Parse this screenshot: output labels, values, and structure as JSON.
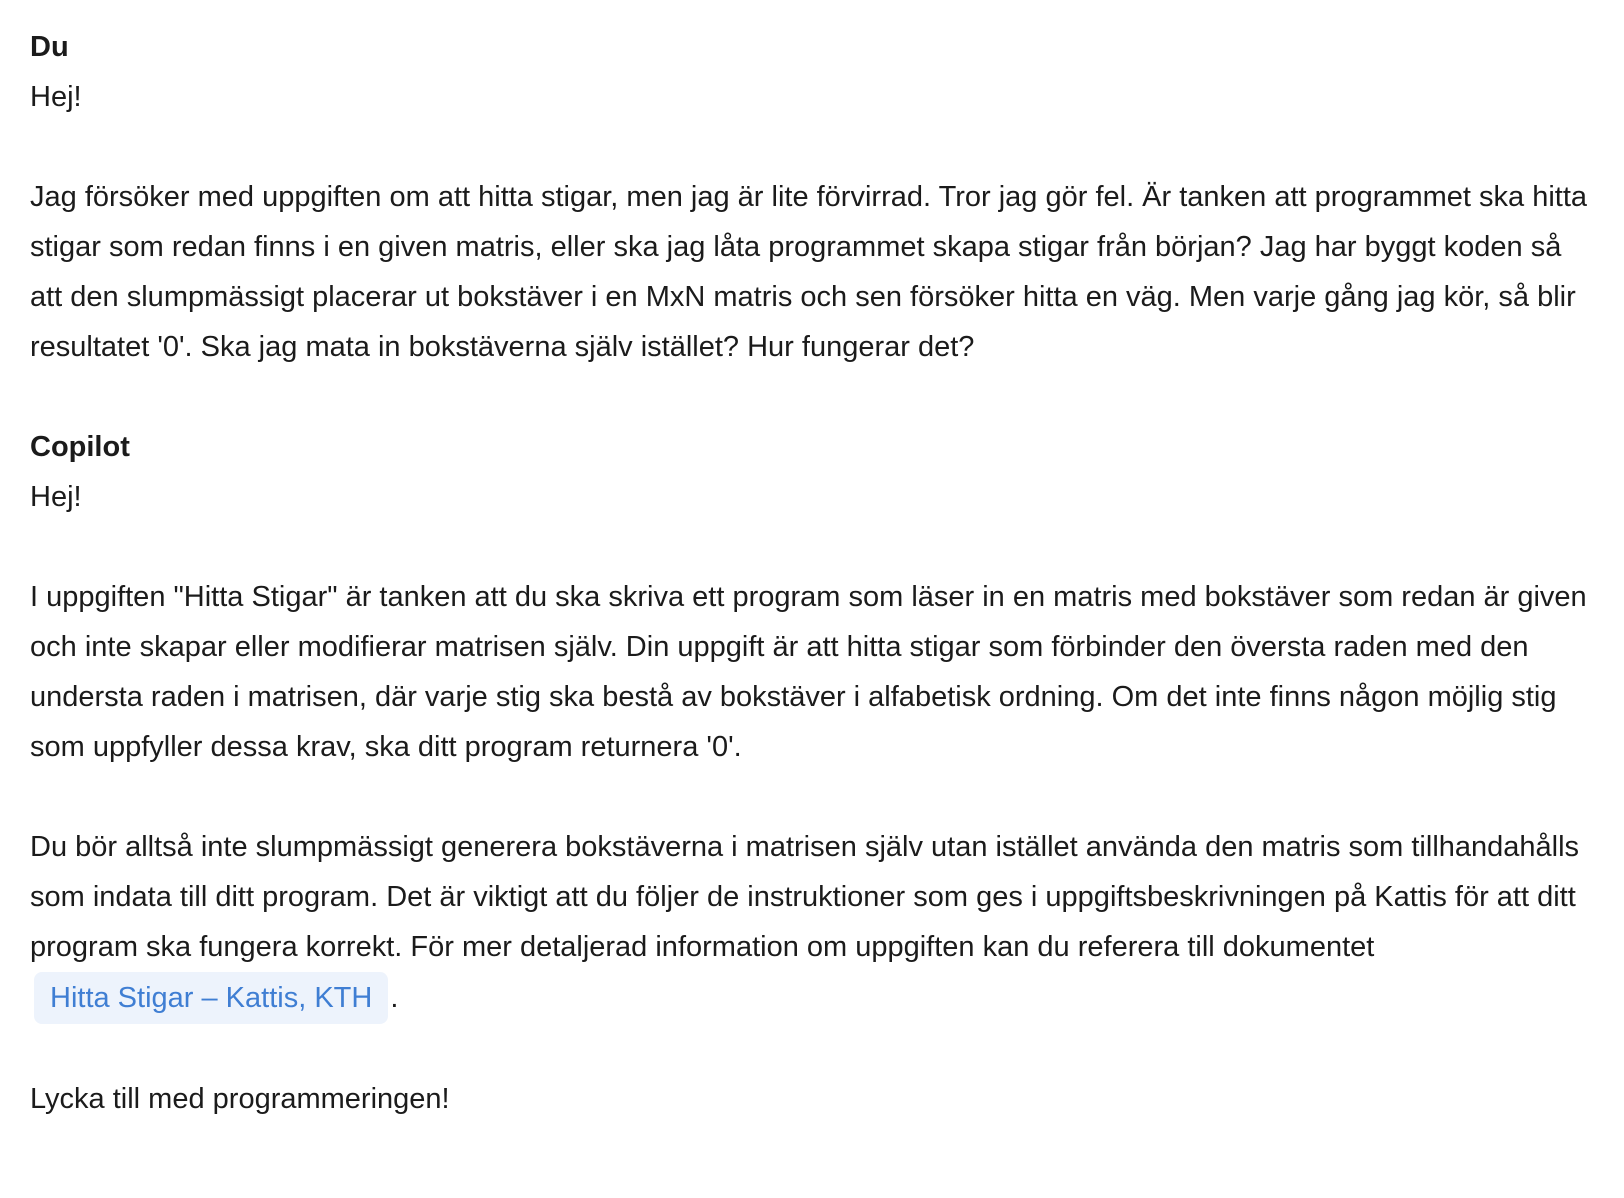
{
  "messages": [
    {
      "author": "Du",
      "paragraphs": [
        "Hej!",
        "Jag försöker med uppgiften om att hitta stigar, men jag är lite förvirrad. Tror jag gör fel. Är tanken att programmet ska hitta stigar som redan finns i en given matris, eller ska jag låta programmet skapa stigar från början? Jag har byggt koden så att den slumpmässigt placerar ut bokstäver i en MxN matris och sen försöker hitta en väg. Men varje gång jag kör, så blir resultatet '0'. Ska jag mata in bokstäverna själv istället? Hur fungerar det?"
      ]
    },
    {
      "author": "Copilot",
      "paragraphs": [
        "Hej!",
        "I uppgiften \"Hitta Stigar\" är tanken att du ska skriva ett program som läser in en matris med bokstäver som redan är given och inte skapar eller modifierar matrisen själv. Din uppgift är att hitta stigar som förbinder den översta raden med den understa raden i matrisen, där varje stig ska bestå av bokstäver i alfabetisk ordning. Om det inte finns någon möjlig stig som uppfyller dessa krav, ska ditt program returnera '0'."
      ],
      "para3_text": "Du bör alltså inte slumpmässigt generera bokstäverna i matrisen själv utan istället använda den matris som tillhandahålls som indata till ditt program. Det är viktigt att du följer de instruktioner som ges i uppgiftsbeskrivningen på Kattis för att ditt program ska fungera korrekt. För mer detaljerad information om uppgiften kan du referera till dokumentet",
      "doc_link_label": "Hitta Stigar – Kattis, KTH",
      "para3_end": ".",
      "closing": "Lycka till med programmeringen!"
    }
  ],
  "colors": {
    "text": "#1b1b1b",
    "link_text": "#3f7ed3",
    "link_background": "#edf3fc"
  }
}
